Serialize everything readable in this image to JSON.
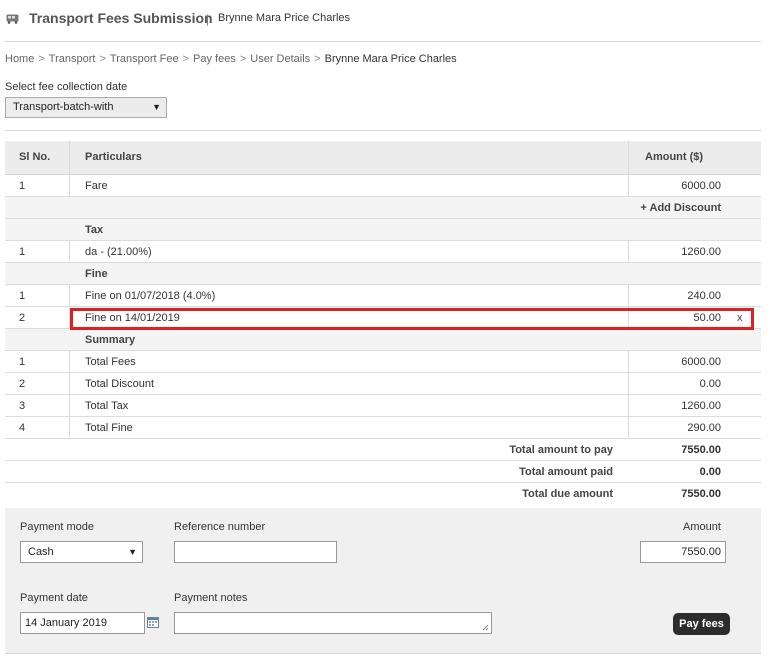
{
  "header": {
    "title": "Transport Fees Submission",
    "separator": "|",
    "user_name": "Brynne Mara Price Charles"
  },
  "breadcrumb": [
    "Home",
    "Transport",
    "Transport Fee",
    "Pay fees",
    "User Details",
    "Brynne Mara Price Charles"
  ],
  "breadcrumb_sep": ">",
  "collection_date": {
    "label": "Select fee collection date",
    "selected": "Transport-batch-with"
  },
  "table": {
    "headers": {
      "sl": "Sl No.",
      "particulars": "Particulars",
      "amount": "Amount ($)"
    },
    "fare_rows": [
      {
        "sl": "1",
        "name": "Fare",
        "amount": "6000.00"
      }
    ],
    "add_discount": "+ Add Discount",
    "tax_heading": "Tax",
    "tax_rows": [
      {
        "sl": "1",
        "name": "da - (21.00%)",
        "amount": "1260.00"
      }
    ],
    "fine_heading": "Fine",
    "fine_rows": [
      {
        "sl": "1",
        "name": "Fine on 01/07/2018 (4.0%)",
        "amount": "240.00"
      },
      {
        "sl": "2",
        "name": "Fine on 14/01/2019",
        "amount": "50.00"
      }
    ],
    "remove_fine_label": "x",
    "summary_heading": "Summary",
    "summary_rows": [
      {
        "sl": "1",
        "name": "Total Fees",
        "amount": "6000.00"
      },
      {
        "sl": "2",
        "name": "Total Discount",
        "amount": "0.00"
      },
      {
        "sl": "3",
        "name": "Total Tax",
        "amount": "1260.00"
      },
      {
        "sl": "4",
        "name": "Total Fine",
        "amount": "290.00"
      }
    ],
    "totals": [
      {
        "label": "Total amount to pay",
        "value": "7550.00"
      },
      {
        "label": "Total amount paid",
        "value": "0.00"
      },
      {
        "label": "Total due amount",
        "value": "7550.00"
      }
    ]
  },
  "payment": {
    "mode_label": "Payment mode",
    "mode_value": "Cash",
    "reference_label": "Reference number",
    "reference_value": "",
    "amount_label": "Amount",
    "amount_value": "7550.00",
    "date_label": "Payment date",
    "date_value": "14 January 2019",
    "notes_label": "Payment notes",
    "notes_value": "",
    "submit_label": "Pay fees"
  },
  "colors": {
    "highlight": "#e02020",
    "button": "#2c2c2c",
    "panel": "#f0f0f0",
    "table_header": "#ececec"
  },
  "icons": [
    "bus-icon",
    "calendar-icon",
    "dropdown-arrow-icon"
  ]
}
